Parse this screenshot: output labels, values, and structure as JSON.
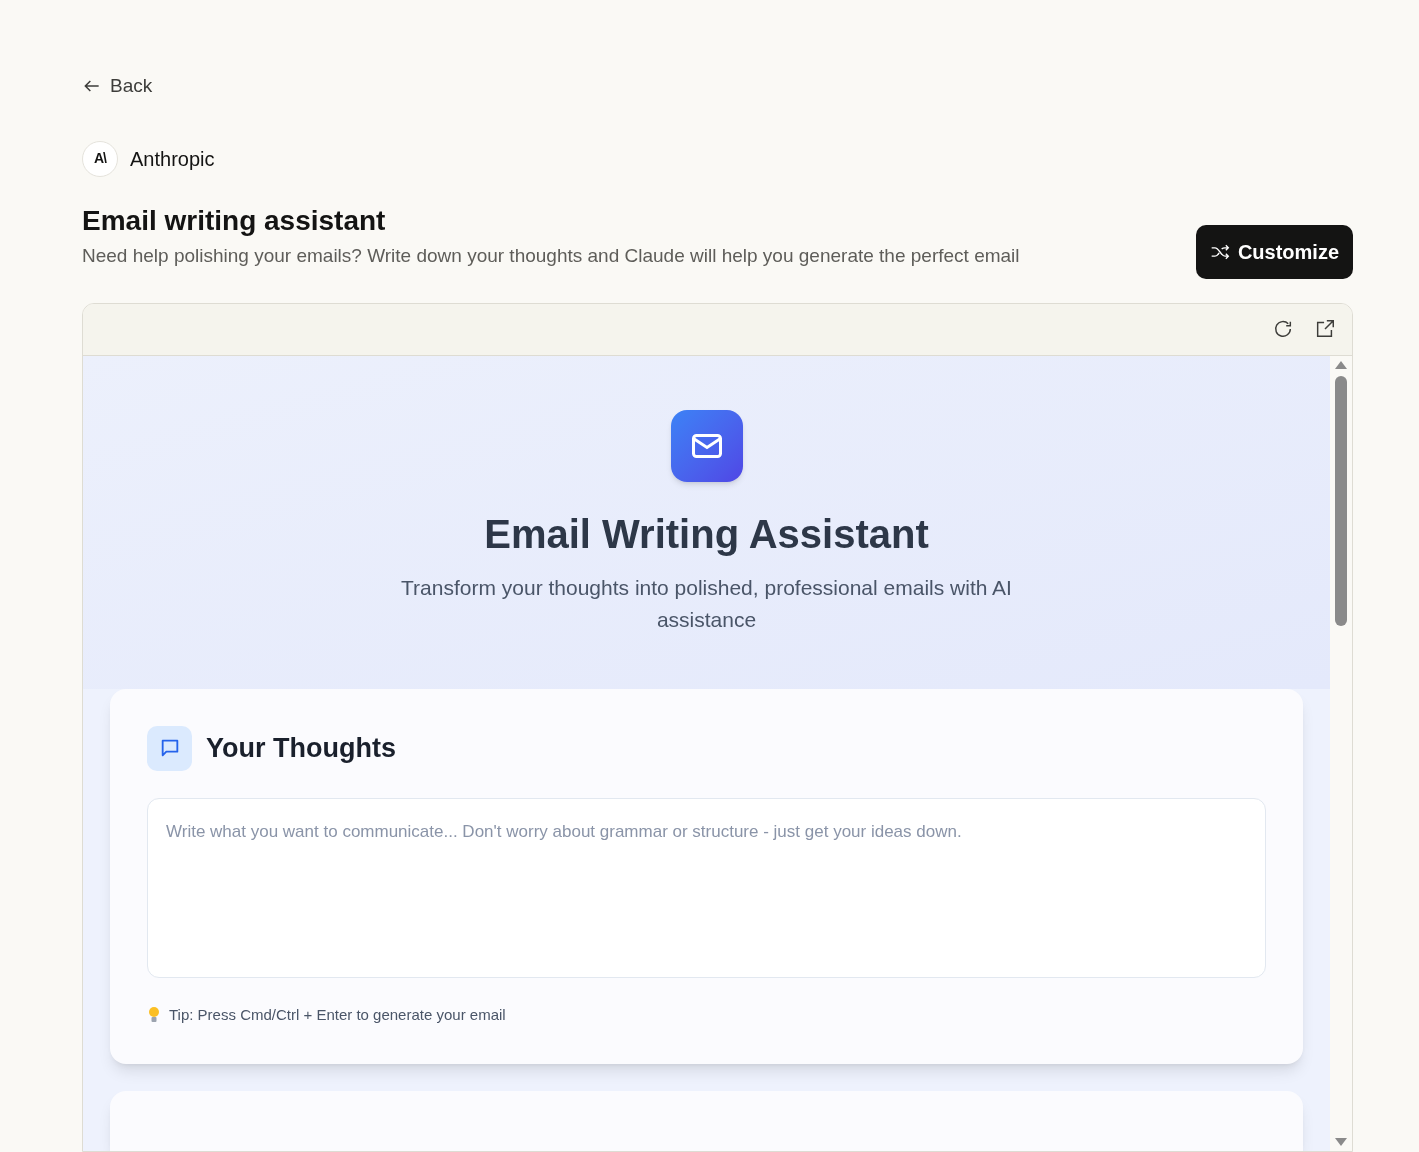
{
  "back_link": "Back",
  "publisher": {
    "logo_text": "A\\",
    "name": "Anthropic"
  },
  "title": "Email writing assistant",
  "description": "Need help polishing your emails? Write down your thoughts and Claude will help you generate the perfect email",
  "customize_button": "Customize",
  "preview": {
    "hero": {
      "title": "Email Writing Assistant",
      "subtitle": "Transform your thoughts into polished, professional emails with AI assistance"
    },
    "thoughts_card": {
      "title": "Your Thoughts",
      "placeholder": "Write what you want to communicate... Don't worry about grammar or structure - just get your ideas down.",
      "tip": "Tip: Press Cmd/Ctrl + Enter to generate your email"
    }
  }
}
